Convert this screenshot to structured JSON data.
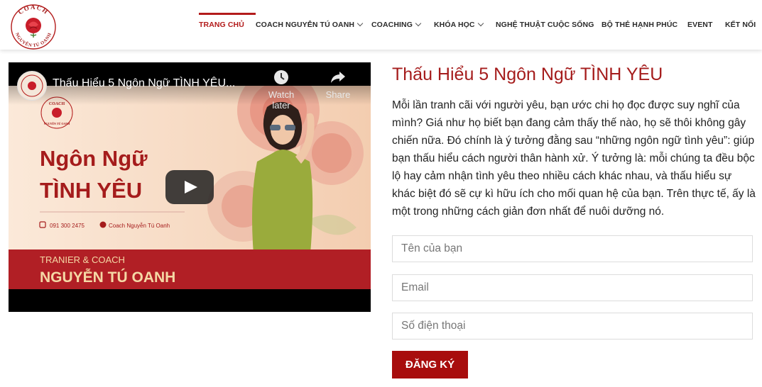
{
  "brand": {
    "logo_top": "COACH",
    "logo_bottom": "NGUYỄN TÚ OANH",
    "accent": "#b31b1b"
  },
  "nav": {
    "items": [
      {
        "label": "TRANG CHỦ",
        "active": true
      },
      {
        "label": "COACH NGUYỄN TÚ OANH",
        "dropdown": true
      },
      {
        "label": "COACHING",
        "dropdown": true
      },
      {
        "label": "KHÓA HỌC",
        "dropdown": true
      },
      {
        "label": "NGHỆ THUẬT CUỘC SỐNG"
      },
      {
        "label": "BỘ THẺ HẠNH PHÚC"
      },
      {
        "label": "EVENT"
      },
      {
        "label": "KẾT NỐI"
      }
    ]
  },
  "video": {
    "title": "Thấu Hiểu 5 Ngôn Ngữ TÌNH YÊU...",
    "watch_later": "Watch later",
    "share": "Share",
    "thumb_logo_top": "COACH",
    "thumb_logo_bottom": "NGUYỄN TÚ OANH",
    "headline_line1": "Ngôn Ngữ",
    "headline_line2": "TÌNH YÊU",
    "phone": "091 300 2475",
    "facebook": "Coach Nguyễn Tú Oanh",
    "role": "TRANIER & COACH",
    "name": "NGUYỄN TÚ OANH"
  },
  "content": {
    "title": "Thấu Hiểu 5 Ngôn Ngữ TÌNH YÊU",
    "description": "Mỗi lần tranh cãi với người yêu, bạn ước chi họ đọc được suy nghĩ của mình? Giá như họ biết bạn đang cảm thấy thế nào, họ sẽ thôi không gây chiến nữa. Đó chính là ý tưởng đằng sau “những ngôn ngữ tình yêu”: giúp bạn thấu hiểu cách người thân hành xử. Ý tưởng là: mỗi chúng ta đều bộc lộ hay cảm nhận tình yêu theo nhiều cách khác nhau, và thấu hiểu sự khác biệt đó sẽ cự kì hữu ích cho mối quan hệ của bạn. Trên thực tế, ấy là một trong những cách giản đơn nhất để nuôi dưỡng nó."
  },
  "form": {
    "name_placeholder": "Tên của bạn",
    "email_placeholder": "Email",
    "phone_placeholder": "Số điện thoại",
    "submit_label": "ĐĂNG KÝ"
  }
}
